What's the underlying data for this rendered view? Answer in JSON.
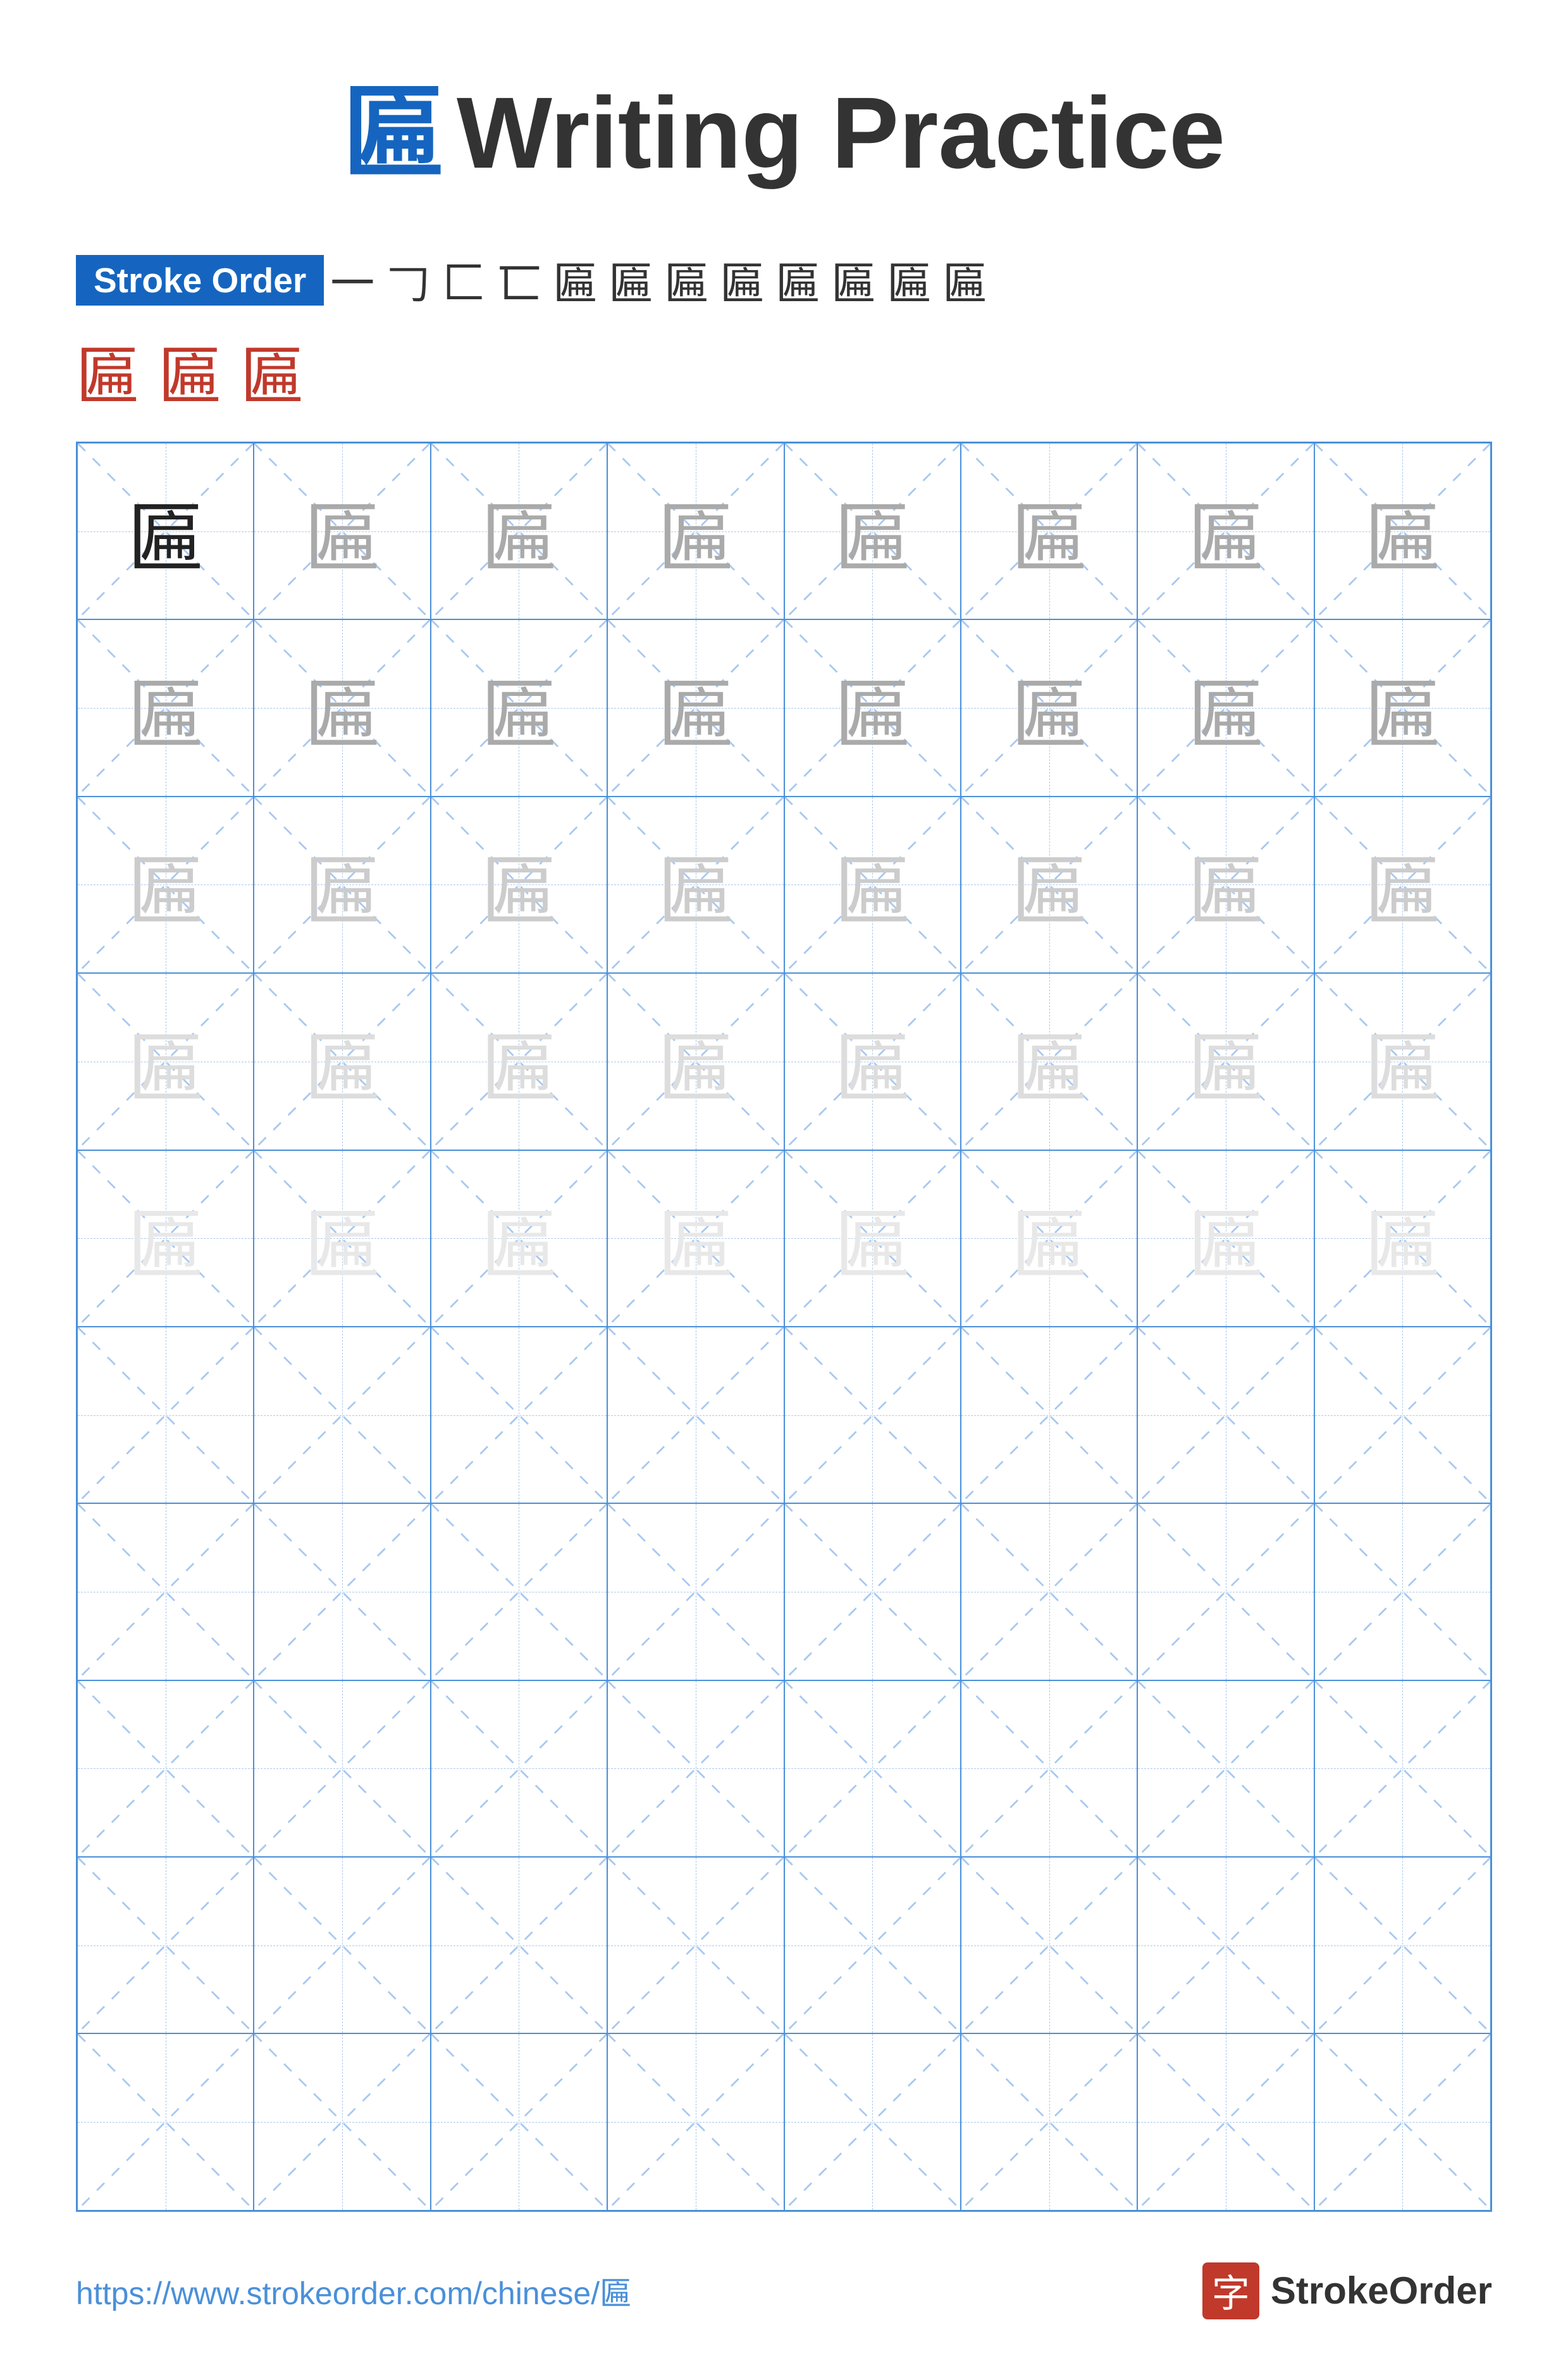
{
  "title": {
    "char": "匾",
    "text": "Writing Practice"
  },
  "stroke_order": {
    "label": "Stroke Order",
    "strokes": [
      "一",
      "𠃌",
      "匚",
      "匸",
      "匾",
      "匾",
      "匾",
      "匾",
      "匾",
      "匾",
      "匾",
      "匾"
    ],
    "large_chars": [
      "匾",
      "匾",
      "匾"
    ]
  },
  "grid": {
    "cols": 8,
    "rows": 10,
    "character": "匾"
  },
  "footer": {
    "url": "https://www.strokeorder.com/chinese/匾",
    "logo_char": "字",
    "logo_text": "StrokeOrder"
  }
}
